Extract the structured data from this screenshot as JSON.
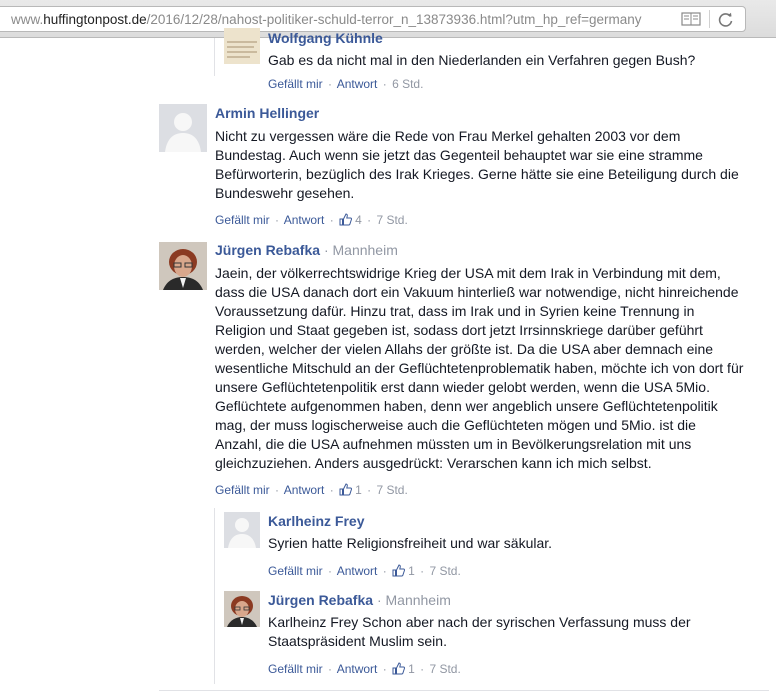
{
  "browser": {
    "url_prefix": "www.",
    "url_domain": "huffingtonpost.de",
    "url_path": "/2016/12/28/nahost-politiker-schuld-terror_n_13873936.html?utm_hp_ref=germany",
    "reader_icon": "reader-icon",
    "reload_icon": "reload-icon"
  },
  "labels": {
    "like": "Gefällt mir",
    "reply": "Antwort",
    "dot": "·"
  },
  "comments": [
    {
      "author": "Wolfgang Kühnle",
      "text": "Gab es da nicht mal in den Niederlanden ein Verfahren gegen Bush?",
      "time": "6 Std."
    },
    {
      "author": "Armin Hellinger",
      "text": "Nicht zu vergessen wäre die Rede von Frau Merkel gehalten 2003 vor dem Bundestag. Auch wenn sie jetzt das Gegenteil behauptet war sie eine stramme Befürworterin, bezüglich des Irak Krieges. Gerne hätte sie eine Beteiligung durch die Bundeswehr gesehen.",
      "likes": "4",
      "time": "7 Std."
    },
    {
      "author": "Jürgen Rebafka",
      "location": "Mannheim",
      "text": "Jaein, der völkerrechtswidrige Krieg der USA mit dem Irak in Verbindung mit dem, dass die USA danach dort ein Vakuum hinterließ war notwendige, nicht hinreichende Voraussetzung dafür. Hinzu trat, dass im Irak und in Syrien keine Trennung in Religion und Staat gegeben ist, sodass dort jetzt Irrsinnskriege darüber geführt werden, welcher der vielen Allahs der größte ist. Da die USA aber demnach eine wesentliche Mitschuld an der Geflüchtetenproblematik haben, möchte ich von dort für unsere Geflüchtetenpolitik erst dann wieder gelobt werden, wenn die USA 5Mio. Geflüchtete aufgenommen haben, denn wer angeblich unsere Geflüchtetenpolitik mag, der muss logischerweise auch die Geflüchteten mögen und 5Mio. ist die Anzahl, die die USA aufnehmen müssten um in Bevölkerungsrelation mit uns gleichzuziehen. Anders ausgedrückt: Verarschen kann ich mich selbst.",
      "likes": "1",
      "time": "7 Std."
    },
    {
      "author": "Karlheinz Frey",
      "text": "Syrien hatte Religionsfreiheit und war säkular.",
      "likes": "1",
      "time": "7 Std."
    },
    {
      "author": "Jürgen Rebafka",
      "location": "Mannheim",
      "text": "Karlheinz Frey Schon aber nach der syrischen Verfassung muss der Staatspräsident Muslim sein.",
      "likes": "1",
      "time": "7 Std."
    }
  ]
}
